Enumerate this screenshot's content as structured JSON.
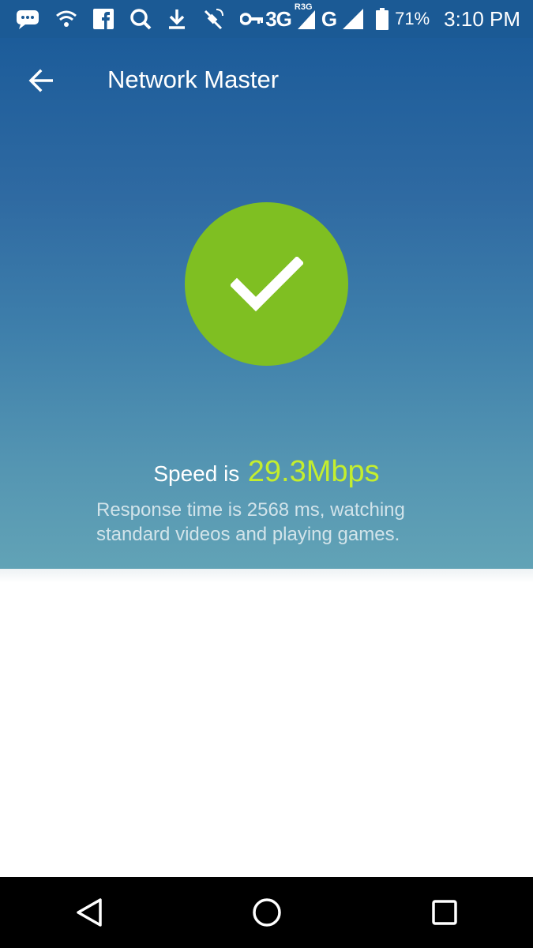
{
  "status_bar": {
    "network_3g": "3G",
    "network_roaming": "R3G",
    "network_g": "G",
    "battery": "71%",
    "time": "3:10 PM",
    "icons": [
      "message-icon",
      "wifi-icon",
      "facebook-icon",
      "search-icon",
      "download-icon",
      "satellite-icon",
      "vpn-key-icon",
      "signal-icon",
      "battery-icon"
    ]
  },
  "app_bar": {
    "title": "Network Master",
    "back_icon": "back-arrow-icon"
  },
  "result": {
    "status_icon": "checkmark-icon",
    "speed_label": "Speed is",
    "speed_value": "29.3Mbps",
    "description": "Response time is 2568 ms, watching standard videos and playing games."
  },
  "nav_bar": {
    "icons": [
      "back-triangle-icon",
      "home-circle-icon",
      "recents-square-icon"
    ]
  },
  "colors": {
    "status_bar": "#1b5a95",
    "gradient_top": "#1c5c9a",
    "gradient_bottom": "#62a3b6",
    "success_green": "#7fbf22",
    "speed_accent": "#c4ee2e"
  }
}
